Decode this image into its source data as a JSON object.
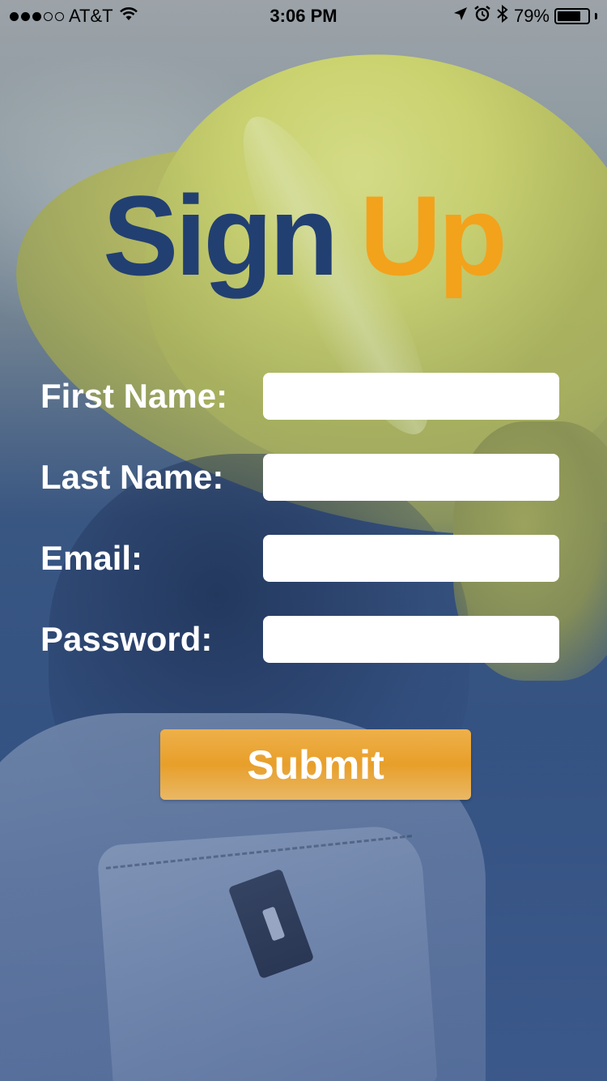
{
  "status_bar": {
    "carrier": "AT&T",
    "time": "3:06 PM",
    "battery_percent": "79%",
    "battery_level": 0.79,
    "signal_bars_filled": 3,
    "signal_bars_total": 5,
    "icons": [
      "wifi-icon",
      "location-arrow-icon",
      "alarm-icon",
      "bluetooth-icon",
      "battery-icon"
    ]
  },
  "title": {
    "word1": "Sign",
    "word2": "Up"
  },
  "colors": {
    "title_primary": "#223f72",
    "title_accent": "#f3a21c",
    "button": "#e89f2a",
    "label": "#ffffff"
  },
  "form": {
    "fields": [
      {
        "label": "First Name:",
        "value": ""
      },
      {
        "label": "Last Name:",
        "value": ""
      },
      {
        "label": "Email:",
        "value": ""
      },
      {
        "label": "Password:",
        "value": ""
      }
    ],
    "submit_label": "Submit"
  }
}
